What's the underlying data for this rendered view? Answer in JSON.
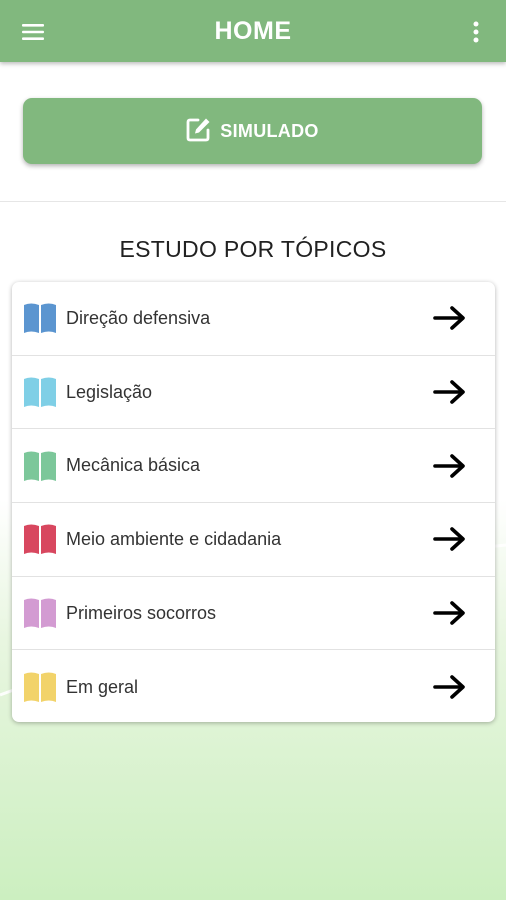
{
  "appbar": {
    "title": "HOME",
    "menu_icon": "hamburger-menu-icon",
    "more_icon": "more-vertical-icon",
    "color": "#81b87e"
  },
  "simulado_button": {
    "label": "SIMULADO",
    "icon": "edit-icon"
  },
  "section": {
    "title": "ESTUDO POR TÓPICOS"
  },
  "topics": [
    {
      "label": "Direção defensiva",
      "icon": "book-icon",
      "color": "#5b95d0"
    },
    {
      "label": "Legislação",
      "icon": "book-icon",
      "color": "#7fcfe6"
    },
    {
      "label": "Mecânica básica",
      "icon": "book-icon",
      "color": "#7cc79a"
    },
    {
      "label": "Meio ambiente e cidadania",
      "icon": "book-icon",
      "color": "#d8475f"
    },
    {
      "label": "Primeiros socorros",
      "icon": "book-icon",
      "color": "#d39bd2"
    },
    {
      "label": "Em geral",
      "icon": "book-icon",
      "color": "#f2d36a"
    }
  ]
}
